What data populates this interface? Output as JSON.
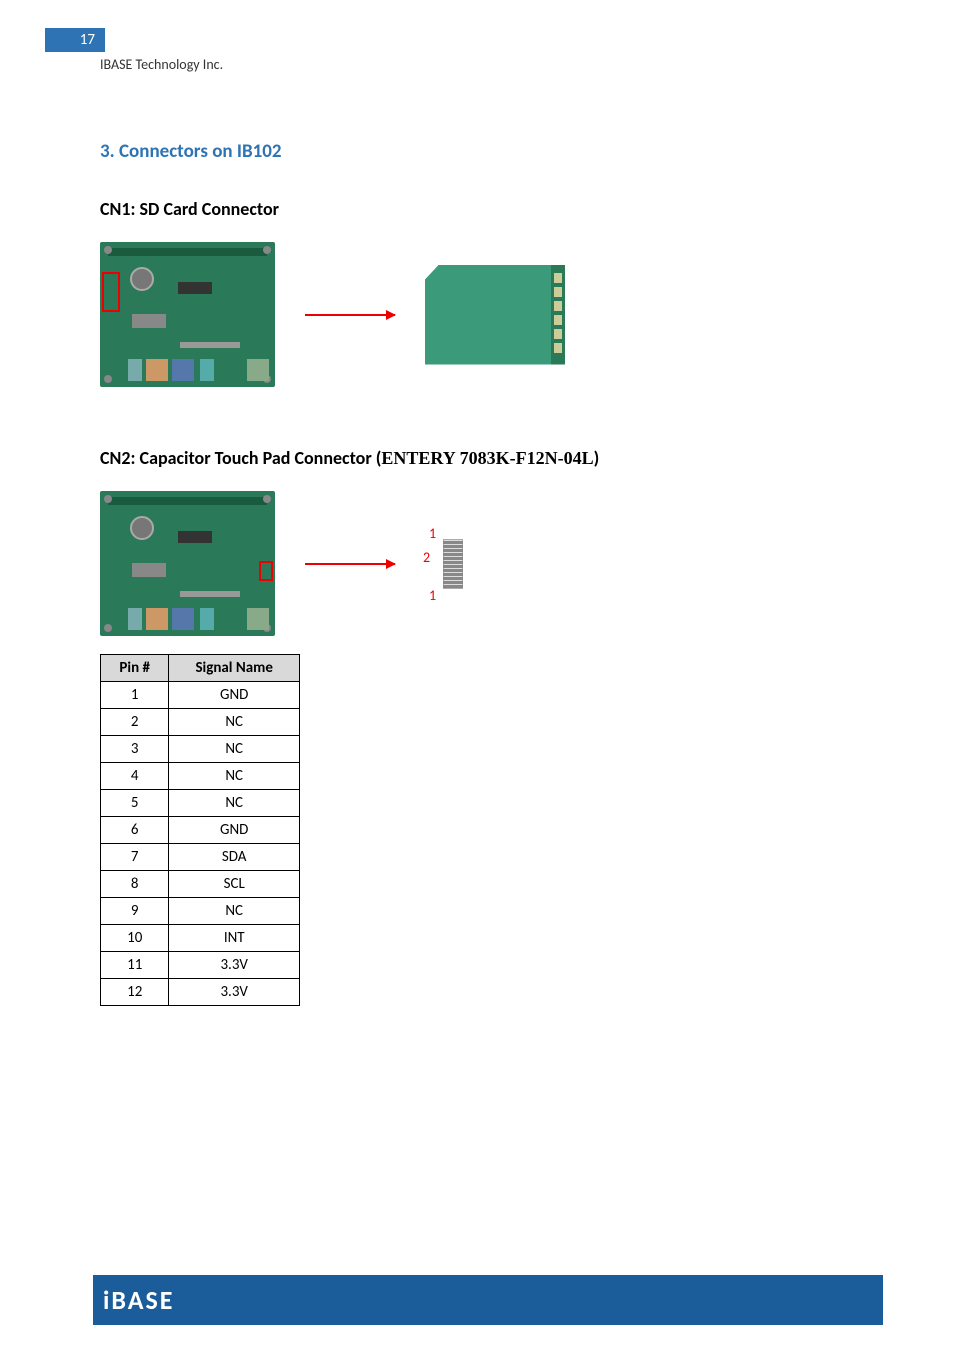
{
  "page_number": "17",
  "company": "IBASE Technology Inc.",
  "section_heading": "3.   Connectors on IB102",
  "cn1_heading": "CN1: SD Card Connector",
  "cn2_heading_prefix": "CN2: Capacitor Touch Pad Connector (",
  "cn2_heading_part": "ENTERY 7083K-F12N-04L",
  "cn2_heading_suffix": ")",
  "labels": {
    "l1": "1",
    "l2": "2",
    "l3": "1"
  },
  "table": {
    "headers": {
      "pin": "Pin #",
      "signal": "Signal Name"
    },
    "rows": [
      {
        "pin": "1",
        "signal": "GND"
      },
      {
        "pin": "2",
        "signal": "NC"
      },
      {
        "pin": "3",
        "signal": "NC"
      },
      {
        "pin": "4",
        "signal": "NC"
      },
      {
        "pin": "5",
        "signal": "NC"
      },
      {
        "pin": "6",
        "signal": "GND"
      },
      {
        "pin": "7",
        "signal": "SDA"
      },
      {
        "pin": "8",
        "signal": "SCL"
      },
      {
        "pin": "9",
        "signal": "NC"
      },
      {
        "pin": "10",
        "signal": "INT"
      },
      {
        "pin": "11",
        "signal": "3.3V"
      },
      {
        "pin": "12",
        "signal": "3.3V"
      }
    ]
  },
  "footer_logo": "iBASE"
}
